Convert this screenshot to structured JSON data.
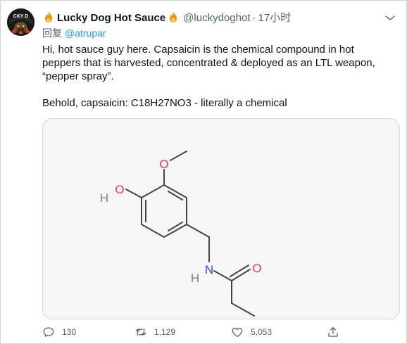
{
  "tweet": {
    "display_name": "Lucky Dog Hot Sauce",
    "handle": "@luckydoghot",
    "separator": "·",
    "time": "17小时",
    "replying_to_label": "回复",
    "replying_to_handle": "@atrupar",
    "body_paragraph_1": "Hi, hot sauce guy here. Capsaicin is the chemical compound in hot peppers that is harvested, concentrated & deployed as an LTL weapon, “pepper spray”.",
    "body_paragraph_2": "Behold, capsaicin: C18H27NO3 - literally a chemical"
  },
  "avatar": {
    "logo_text": "CKY D"
  },
  "media": {
    "atom_labels": {
      "methoxy_o": "O",
      "hydroxyl_o": "O",
      "hydroxyl_h": "H",
      "amide_n": "N",
      "amide_h": "H",
      "carbonyl_o": "O"
    }
  },
  "actions": {
    "reply_count": "130",
    "retweet_count": "1,129",
    "like_count": "5,053"
  },
  "colors": {
    "link": "#1d9bf0",
    "secondary_text": "#536471",
    "oxygen": "#e8383d",
    "nitrogen": "#2a4fd6",
    "hydrogen": "#7f7f7f",
    "bond": "#444444"
  },
  "icons": [
    "fire-emoji-icon",
    "more-options-icon",
    "reply-icon",
    "retweet-icon",
    "like-icon",
    "share-icon"
  ]
}
